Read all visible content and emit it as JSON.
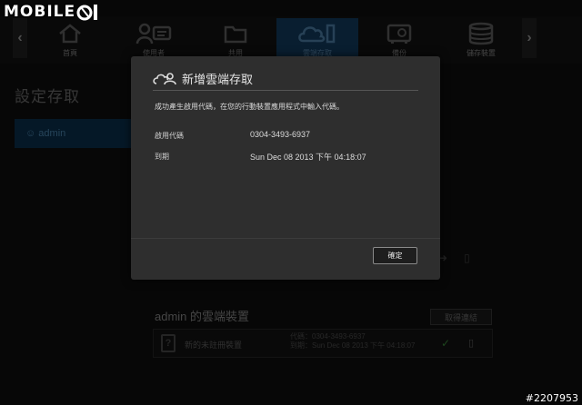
{
  "watermark": {
    "logo_text": "MOBILE"
  },
  "nav": {
    "items": [
      {
        "label": "首頁",
        "icon": "home-icon",
        "active": false
      },
      {
        "label": "使用者",
        "icon": "users-icon",
        "active": false
      },
      {
        "label": "共用",
        "icon": "folder-icon",
        "active": false
      },
      {
        "label": "雲端存取",
        "icon": "cloud-icon",
        "active": true
      },
      {
        "label": "備份",
        "icon": "safe-icon",
        "active": false
      },
      {
        "label": "儲存裝置",
        "icon": "storage-icon",
        "active": false
      }
    ],
    "prev_icon": "‹",
    "next_icon": "›"
  },
  "page": {
    "title": "設定存取",
    "selected_user": "admin",
    "devices_title": "admin 的雲端裝置",
    "unpair_label": "取得連結",
    "device": {
      "name": "新的未註冊裝置",
      "code_line": "代碼：0304-3493-6937",
      "expire_line": "到期：Sun Dec 08 2013 下午 04:18:07"
    }
  },
  "dialog": {
    "title": "新增雲端存取",
    "message": "成功產生啟用代碼，在您的行動裝置應用程式中輸入代碼。",
    "fields": [
      {
        "label": "啟用代碼",
        "value": "0304-3493-6937"
      },
      {
        "label": "到期",
        "value": "Sun Dec 08 2013 下午 04:18:07"
      }
    ],
    "ok_label": "確定"
  },
  "image_id": "#2207953"
}
